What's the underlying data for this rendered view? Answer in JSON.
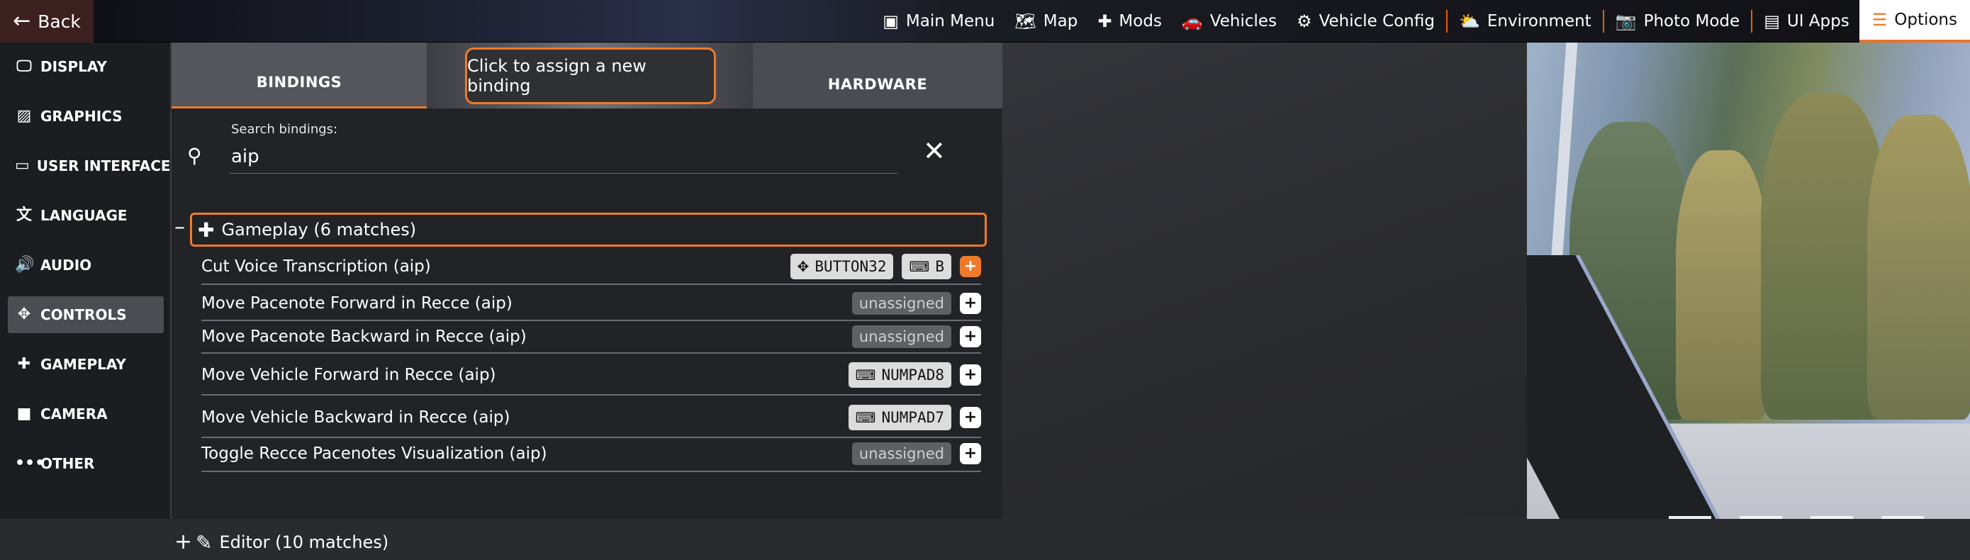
{
  "topbar": {
    "back_label": "Back",
    "nav": [
      {
        "label": "Main Menu",
        "icon": "main-menu-icon",
        "glyph": "▣"
      },
      {
        "label": "Map",
        "icon": "map-icon",
        "glyph": "🗺"
      },
      {
        "label": "Mods",
        "icon": "puzzle-icon",
        "glyph": "✚"
      },
      {
        "label": "Vehicles",
        "icon": "car-icon",
        "glyph": "🚗"
      },
      {
        "label": "Vehicle Config",
        "icon": "engine-icon",
        "glyph": "⚙"
      },
      {
        "label": "Environment",
        "icon": "weather-icon",
        "glyph": "⛅"
      },
      {
        "label": "Photo Mode",
        "icon": "camera-icon",
        "glyph": "📷"
      },
      {
        "label": "UI Apps",
        "icon": "ui-apps-icon",
        "glyph": "▤"
      },
      {
        "label": "Options",
        "icon": "sliders-icon",
        "glyph": "☰"
      }
    ],
    "active": "Options"
  },
  "sidebar": {
    "items": [
      {
        "label": "DISPLAY",
        "icon": "monitor-icon",
        "glyph": "🖵"
      },
      {
        "label": "GRAPHICS",
        "icon": "image-icon",
        "glyph": "▨"
      },
      {
        "label": "USER INTERFACE",
        "icon": "ui-window-icon",
        "glyph": "▭"
      },
      {
        "label": "LANGUAGE",
        "icon": "translate-icon",
        "glyph": "文"
      },
      {
        "label": "AUDIO",
        "icon": "speaker-icon",
        "glyph": "🔊"
      },
      {
        "label": "CONTROLS",
        "icon": "gamepad-icon",
        "glyph": "✥"
      },
      {
        "label": "GAMEPLAY",
        "icon": "puzzle-icon",
        "glyph": "✚"
      },
      {
        "label": "CAMERA",
        "icon": "video-camera-icon",
        "glyph": "■"
      },
      {
        "label": "OTHER",
        "icon": "more-icon",
        "glyph": "•••"
      }
    ],
    "active": "CONTROLS"
  },
  "tabs": {
    "bindings": "BINDINGS",
    "hardware": "HARDWARE",
    "tooltip": "Click to assign a new binding"
  },
  "search": {
    "label": "Search bindings:",
    "value": "aip"
  },
  "groups": [
    {
      "title": "Gameplay (6 matches)",
      "icon": "puzzle-icon",
      "expanded": true,
      "toggle": "–"
    },
    {
      "title": "Editor (10 matches)",
      "icon": "pencil-icon",
      "expanded": false,
      "toggle": "+"
    }
  ],
  "bindings": [
    {
      "label": "Cut Voice Transcription (aip)",
      "chips": [
        {
          "icon": "gamepad-icon",
          "glyph": "✥",
          "text": "BUTTON32"
        },
        {
          "icon": "keyboard-icon",
          "glyph": "⌨",
          "text": "B"
        }
      ],
      "highlight_add": true
    },
    {
      "label": "Move Pacenote Forward in Recce (aip)",
      "unassigned": "unassigned"
    },
    {
      "label": "Move Pacenote Backward in Recce (aip)",
      "unassigned": "unassigned"
    },
    {
      "label": "Move Vehicle Forward in Recce (aip)",
      "chips": [
        {
          "icon": "keyboard-icon",
          "glyph": "⌨",
          "text": "NUMPAD8"
        }
      ]
    },
    {
      "label": "Move Vehicle Backward in Recce (aip)",
      "chips": [
        {
          "icon": "keyboard-icon",
          "glyph": "⌨",
          "text": "NUMPAD7"
        }
      ]
    },
    {
      "label": "Toggle Recce Pacenotes Visualization (aip)",
      "unassigned": "unassigned"
    }
  ],
  "add_glyph": "+",
  "clear_glyph": "✕",
  "colors": {
    "accent": "#f07a2a",
    "panel": "#222326",
    "sidebar": "#1c1d21"
  }
}
